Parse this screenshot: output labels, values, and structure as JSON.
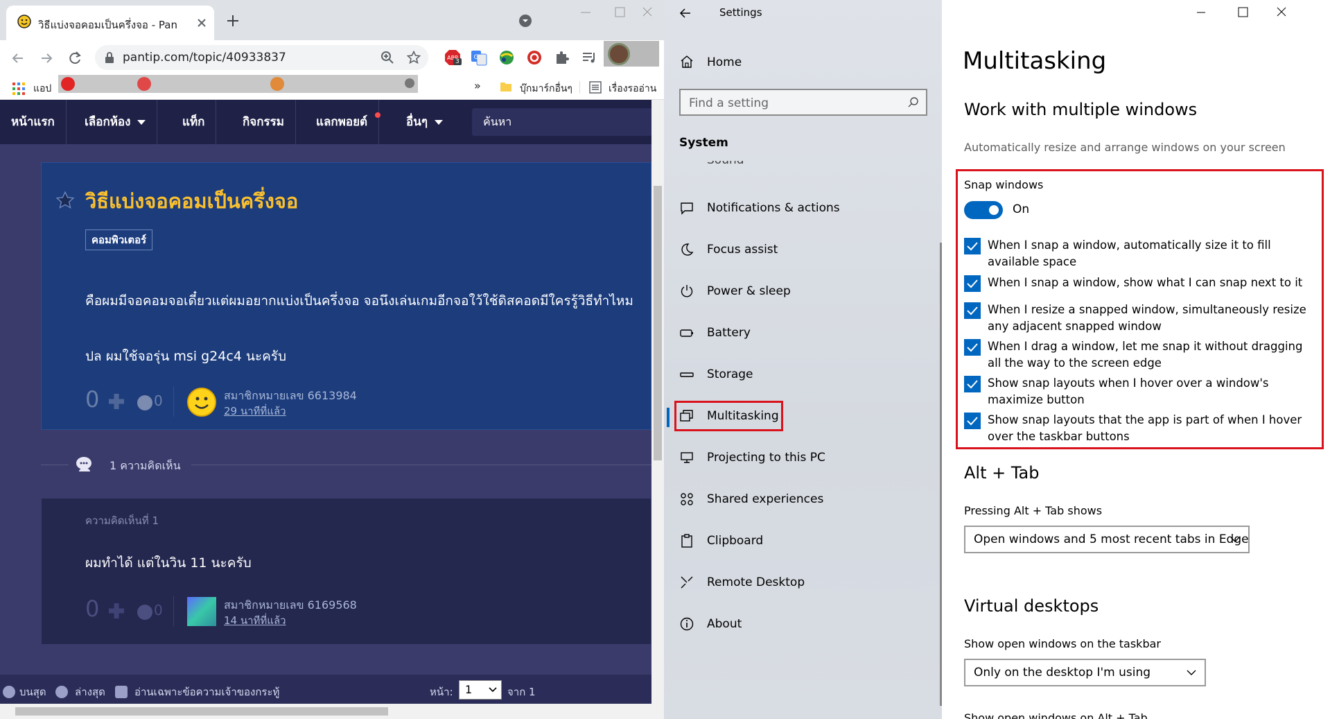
{
  "browser": {
    "tab_title": "วิธีแบ่งจอคอมเป็นครึ่งจอ - Pantip",
    "url": "pantip.com/topic/40933837",
    "ext_badge": "3",
    "bookmarks": {
      "apps_label": "แอป",
      "overflow": "»",
      "other_label": "บุ๊กมาร์กอื่นๆ",
      "reading_list_label": "เรื่องรออ่าน"
    },
    "icons": [
      "pantip-favicon",
      "close-icon",
      "plus-icon",
      "tab-search-icon",
      "back-icon",
      "forward-icon",
      "reload-icon",
      "lock-icon",
      "zoom-icon",
      "star-icon",
      "puzzle-icon",
      "media-icon",
      "folder-icon",
      "list-icon"
    ]
  },
  "pantip": {
    "nav": [
      "หน้าแรก",
      "เลือกห้อง",
      "แท็ก",
      "กิจกรรม",
      "แลกพอยต์",
      "อื่นๆ"
    ],
    "search_placeholder": "ค้นหา",
    "topic": {
      "title": "วิธีแบ่งจอคอมเป็นครึ่งจอ",
      "tag": "คอมพิวเตอร์",
      "body_line1": "คือผมมีจอคอมจอเดี๋ยวแต่ผมอยากแบ่งเป็นครึ่งจอ จอนึงเล่นเกมอีกจอใว้ใช้ดิสคอดมีใครรู้วิธีทำไหม",
      "body_line2": "ปล ผมใช้จอรุ่น msi g24c4 นะครับ",
      "votes": "0",
      "emotions": "0",
      "author": "สมาชิกหมายเลข 6613984",
      "time": "29 นาทีที่แล้ว"
    },
    "comments_count": "1 ความคิดเห็น",
    "comment": {
      "number": "ความคิดเห็นที่ 1",
      "text": "ผมทำได้ แต่ในวิน 11 นะครับ",
      "votes": "0",
      "emotions": "0",
      "author": "สมาชิกหมายเลข 6169568",
      "time": "14 นาทีที่แล้ว"
    },
    "bottom": {
      "top": "บนสุด",
      "bottom": "ล่างสุด",
      "owner_only": "อ่านเฉพาะข้อความเจ้าของกระทู้",
      "page_label": "หน้า:",
      "page_value": "1",
      "of_label": "จาก 1"
    }
  },
  "settings": {
    "app_title": "Settings",
    "home": "Home",
    "search_placeholder": "Find a setting",
    "section": "System",
    "partial_item": "Sound",
    "nav": [
      "Notifications & actions",
      "Focus assist",
      "Power & sleep",
      "Battery",
      "Storage",
      "Multitasking",
      "Projecting to this PC",
      "Shared experiences",
      "Clipboard",
      "Remote Desktop",
      "About"
    ],
    "active_nav": "Multitasking",
    "page_title": "Multitasking",
    "work_heading": "Work with multiple windows",
    "work_desc": "Automatically resize and arrange windows on your screen",
    "snap_label": "Snap windows",
    "snap_state": "On",
    "snap_options": [
      "When I snap a window, automatically size it to fill available space",
      "When I snap a window, show what I can snap next to it",
      "When I resize a snapped window, simultaneously resize any adjacent snapped window",
      "When I drag a window, let me snap it without dragging all the way to the screen edge",
      "Show snap layouts when I hover over a window's maximize button",
      "Show snap layouts that the app is part of when I hover over the taskbar buttons"
    ],
    "alttab_heading": "Alt + Tab",
    "alttab_label": "Pressing Alt + Tab shows",
    "alttab_value": "Open windows and 5 most recent tabs in Edge",
    "vd_heading": "Virtual desktops",
    "vd_label": "Show open windows on the taskbar",
    "vd_value": "Only on the desktop I'm using",
    "partial_label": "Show open windows on Alt + Tab",
    "accent": "#0067c0",
    "highlight": "#d9121c"
  }
}
